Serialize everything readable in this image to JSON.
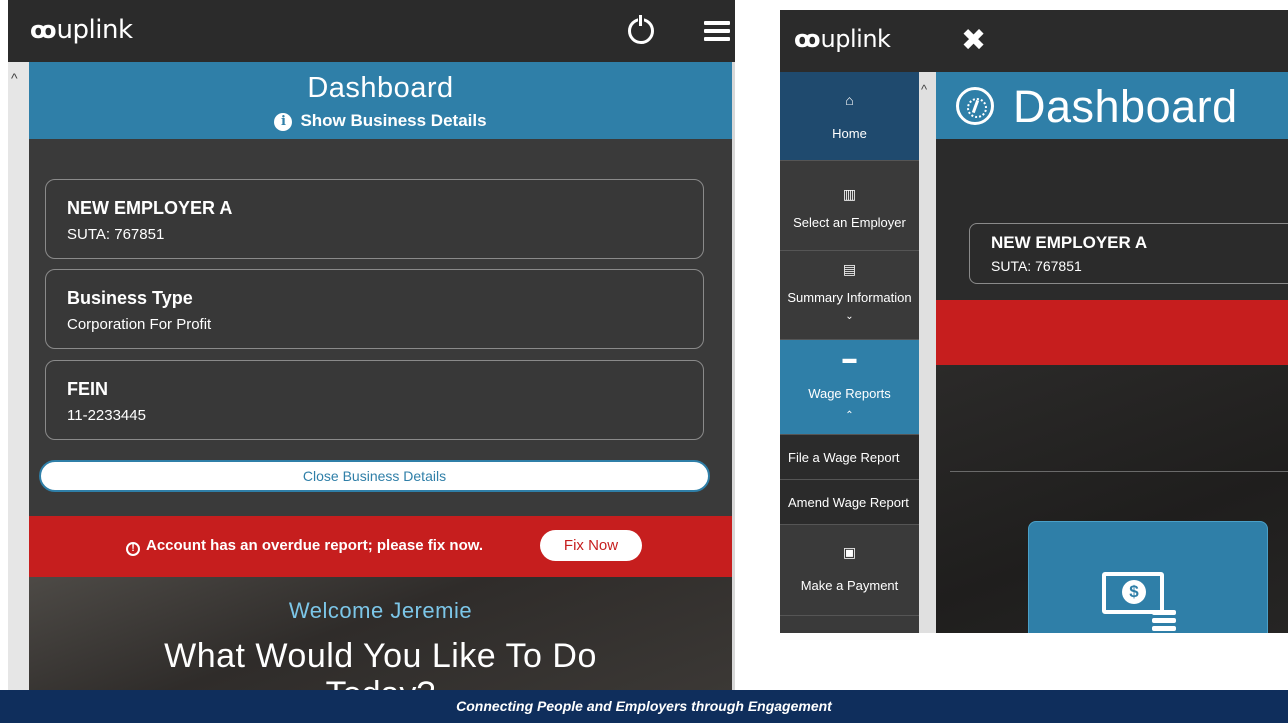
{
  "left_screen": {
    "brand": {
      "mark": "ꝏ",
      "name": "uplink"
    },
    "header": {
      "title": "Dashboard",
      "show_details": "Show Business Details"
    },
    "business_cards": [
      {
        "title": "NEW EMPLOYER A",
        "value": "SUTA: 767851"
      },
      {
        "title": "Business Type",
        "value": "Corporation For Profit"
      },
      {
        "title": "FEIN",
        "value": "11-2233445"
      }
    ],
    "close_details_label": "Close Business Details",
    "alert": {
      "message": "Account has an overdue report; please fix now.",
      "action_label": "Fix Now"
    },
    "welcome": "Welcome Jeremie",
    "question": "What Would You Like To Do",
    "question_cont": "Today?"
  },
  "right_screen": {
    "brand": {
      "mark": "ꝏ",
      "name": "uplink"
    },
    "close_symbol": "✖",
    "sidebar": {
      "items": [
        {
          "icon": "home-icon",
          "glyph": "⌂",
          "label": "Home"
        },
        {
          "icon": "building-icon",
          "glyph": "▥",
          "label": "Select an Employer"
        },
        {
          "icon": "list-icon",
          "glyph": "▤",
          "label": "Summary Information",
          "chevron": "⌄"
        },
        {
          "icon": "folder-icon",
          "glyph": "▬",
          "label": "Wage Reports",
          "chevron": "⌃"
        },
        {
          "icon": "money-icon",
          "glyph": "▣",
          "label": "Make a Payment"
        }
      ],
      "sub_items": [
        "File a Wage Report",
        "Amend Wage Report"
      ]
    },
    "header": {
      "title": "Dashboard"
    },
    "business_card": {
      "title": "NEW EMPLOYER A",
      "value": "SUTA: 767851"
    },
    "tile_currency": "$"
  },
  "footer": {
    "tagline": "Connecting People and Employers through Engagement"
  },
  "colors": {
    "accent": "#2f7fa8",
    "alert": "#c61e1e",
    "footer": "#0f2e5c",
    "dark": "#2b2b2b"
  }
}
